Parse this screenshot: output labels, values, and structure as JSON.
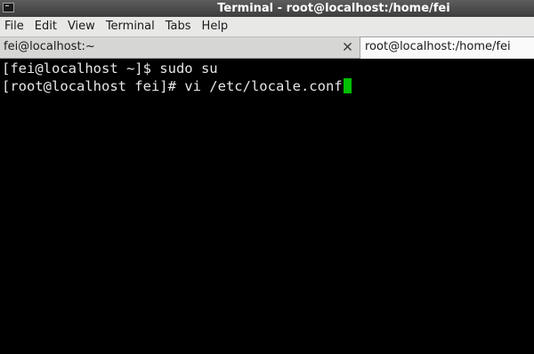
{
  "window": {
    "title": "Terminal - root@localhost:/home/fei",
    "icon": "terminal-icon"
  },
  "menubar": {
    "items": [
      {
        "label": "File"
      },
      {
        "label": "Edit"
      },
      {
        "label": "View"
      },
      {
        "label": "Terminal"
      },
      {
        "label": "Tabs"
      },
      {
        "label": "Help"
      }
    ]
  },
  "tabs": [
    {
      "label": "fei@localhost:~",
      "active": false,
      "close_icon": "close-icon"
    },
    {
      "label": "root@localhost:/home/fei",
      "active": true
    }
  ],
  "terminal": {
    "lines": [
      "[fei@localhost ~]$ sudo su",
      "[root@localhost fei]# vi /etc/locale.conf"
    ],
    "cursor_color": "#00c000"
  },
  "colors": {
    "background": "#000000",
    "foreground": "#e6e6e6",
    "titlebar": "#4a4a4a"
  }
}
